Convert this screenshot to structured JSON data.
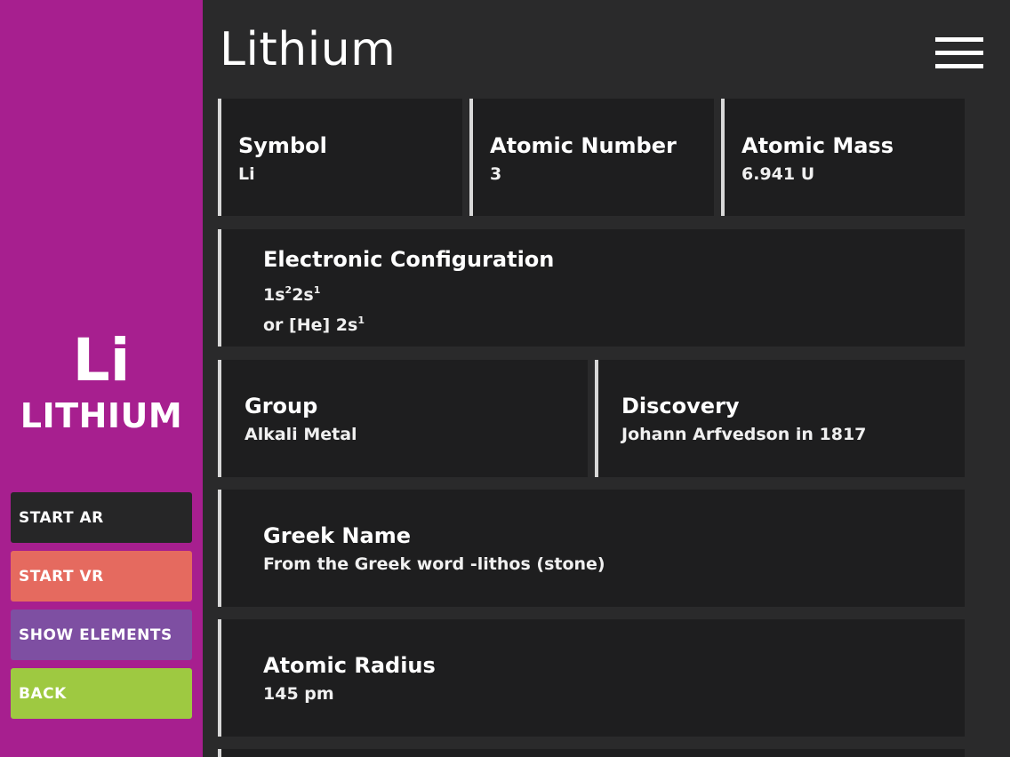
{
  "sidebar": {
    "symbol": "Li",
    "name": "LITHIUM",
    "buttons": {
      "start_ar": "START AR",
      "start_vr": "START VR",
      "show_elements": "SHOW ELEMENTS",
      "back": "BACK"
    }
  },
  "header": {
    "title": "Lithium",
    "menu_icon": "hamburger-menu-icon"
  },
  "cards": {
    "symbol": {
      "label": "Symbol",
      "value": "Li"
    },
    "atomic_number": {
      "label": "Atomic Number",
      "value": "3"
    },
    "atomic_mass": {
      "label": "Atomic Mass",
      "value": "6.941 U"
    },
    "electronic_configuration": {
      "label": "Electronic Configuration",
      "line1": {
        "a": "1s",
        "a_sup": "2",
        "b": "2s",
        "b_sup": "1"
      },
      "line2": {
        "text": "or [He] 2s",
        "sup": "1"
      }
    },
    "group": {
      "label": "Group",
      "value": "Alkali Metal"
    },
    "discovery": {
      "label": "Discovery",
      "value": "Johann Arfvedson in 1817"
    },
    "greek_name": {
      "label": "Greek Name",
      "value": "From the Greek word -lithos (stone)"
    },
    "atomic_radius": {
      "label": "Atomic Radius",
      "value": "145 pm"
    }
  },
  "colors": {
    "sidebar_bg": "#a71f8f",
    "main_bg": "#2a2a2b",
    "card_bg": "#1e1e1f",
    "card_accent": "#d8d8d8",
    "start_ar_bg": "#262627",
    "start_vr_bg": "#e56a5f",
    "show_elements_bg": "#7e4fa2",
    "back_bg": "#9ec941"
  }
}
